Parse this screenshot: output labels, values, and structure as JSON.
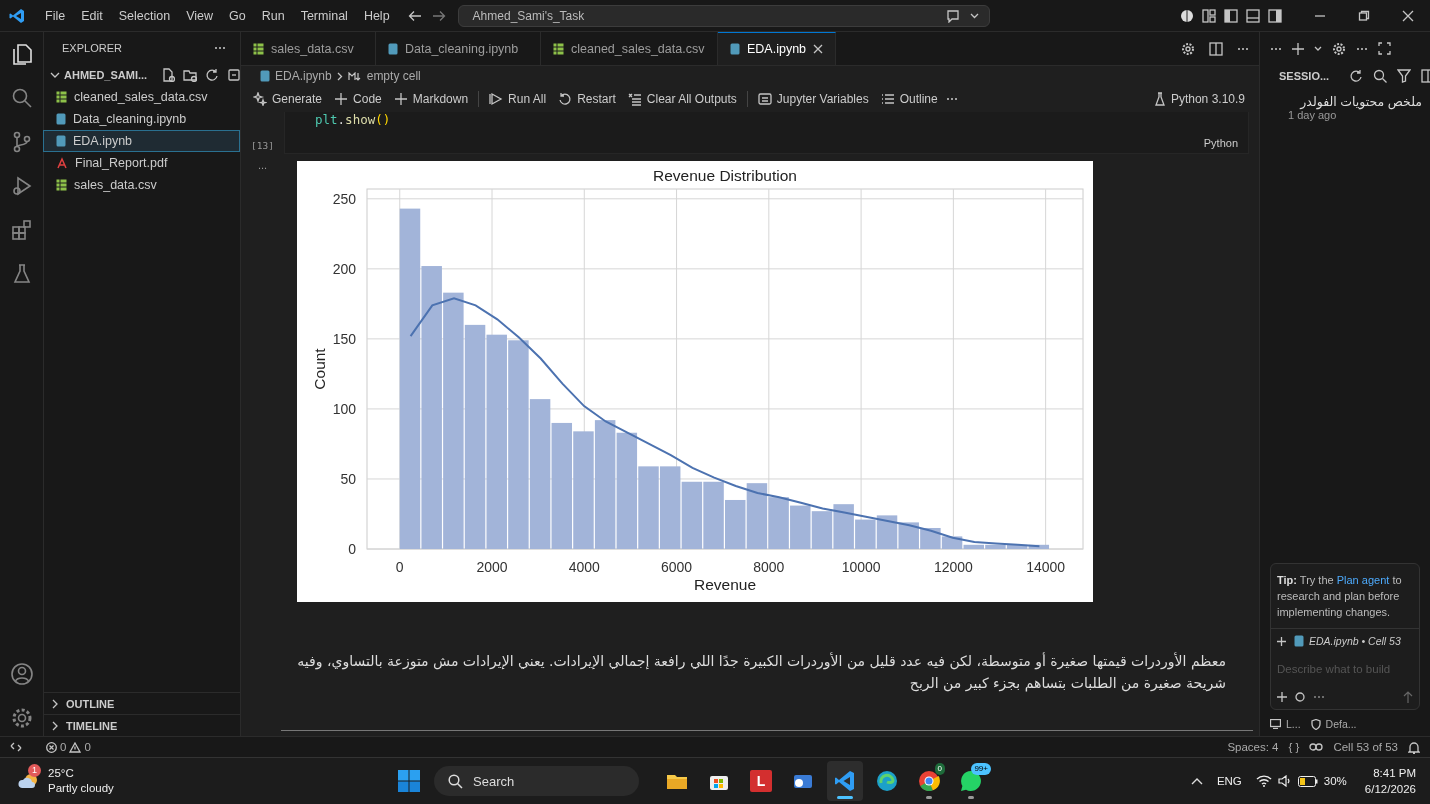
{
  "title_bar": {
    "menu": [
      "File",
      "Edit",
      "Selection",
      "View",
      "Go",
      "Run",
      "Terminal",
      "Help"
    ],
    "search": "Ahmed_Sami's_Task"
  },
  "sidebar": {
    "title": "EXPLORER",
    "folder": {
      "name": "AHMED_SAMI...",
      "expanded": true
    },
    "files": [
      {
        "name": "cleaned_sales_data.csv",
        "kind": "csv",
        "selected": false
      },
      {
        "name": "Data_cleaning.ipynb",
        "kind": "ipynb",
        "selected": false
      },
      {
        "name": "EDA.ipynb",
        "kind": "ipynb",
        "selected": true
      },
      {
        "name": "Final_Report.pdf",
        "kind": "pdf",
        "selected": false
      },
      {
        "name": "sales_data.csv",
        "kind": "csv",
        "selected": false
      }
    ],
    "sections": [
      {
        "label": "OUTLINE",
        "expanded": false
      },
      {
        "label": "TIMELINE",
        "expanded": false
      }
    ]
  },
  "editor": {
    "tabs": [
      {
        "label": "sales_data.csv",
        "kind": "csv",
        "selected": false
      },
      {
        "label": "Data_cleaning.ipynb",
        "kind": "ipynb",
        "selected": false
      },
      {
        "label": "cleaned_sales_data.csv",
        "kind": "csv",
        "selected": false
      },
      {
        "label": "EDA.ipynb",
        "kind": "ipynb",
        "selected": true
      }
    ],
    "breadcrumb": [
      "EDA.ipynb",
      "empty cell"
    ],
    "toolbar": [
      {
        "label": "Generate",
        "kind": "sparkle"
      },
      {
        "label": "Code",
        "kind": "plus"
      },
      {
        "label": "Markdown",
        "kind": "plus"
      },
      {
        "label": "Run All",
        "kind": "run"
      },
      {
        "label": "Restart",
        "kind": "restart"
      },
      {
        "label": "Clear All Outputs",
        "kind": "clear"
      },
      {
        "label": "Jupyter Variables",
        "kind": "variables"
      },
      {
        "label": "Outline",
        "kind": "list"
      }
    ],
    "kernel": "Python 3.10.9",
    "cell": {
      "code": [
        {
          "text": "plt",
          "kind": "object"
        },
        {
          "text": ".",
          "kind": "punct"
        },
        {
          "text": "show",
          "kind": "function"
        },
        {
          "text": "()",
          "kind": "paren"
        }
      ],
      "exec_count": "[13]",
      "language": "Python",
      "output_marker": "...",
      "chart_data": {
        "type": "bar",
        "title": "Revenue Distribution",
        "xlabel": "Revenue",
        "ylabel": "Count",
        "x": [
          235,
          705,
          1175,
          1645,
          2115,
          2585,
          3055,
          3525,
          3995,
          4465,
          4935,
          5405,
          5875,
          6345,
          6815,
          7285,
          7755,
          8225,
          8695,
          9165,
          9635,
          10105,
          10575,
          11045,
          11515,
          11985,
          12455,
          12925,
          13395,
          13865
        ],
        "series": [
          {
            "color": "#a2b4d9",
            "values": [
              243,
              202,
              183,
              160,
              153,
              149,
              107,
              90,
              84,
              92,
              83,
              59,
              59,
              48,
              48,
              35,
              47,
              37,
              31,
              27,
              32,
              21,
              24,
              19,
              15,
              9,
              3,
              3,
              3,
              3
            ]
          },
          {
            "type": "line",
            "color": "#4c72b0",
            "values": [
              152,
              174,
              179,
              174,
              164,
              151,
              136,
              118,
              102,
              91,
              83,
              75,
              67,
              58,
              51,
              45,
              40,
              37,
              33,
              29,
              26,
              23,
              20,
              17,
              13,
              8,
              5,
              4,
              3,
              2
            ]
          }
        ],
        "grid": true,
        "xlim": [
          -710,
          14810
        ],
        "ylim": [
          0,
          257
        ],
        "xticks": [
          0,
          2000,
          4000,
          6000,
          8000,
          10000,
          12000,
          14000
        ],
        "yticks": [
          0,
          50,
          100,
          150,
          200,
          250
        ]
      },
      "markdown": "معظم الأوردرات قيمتها صغيرة أو متوسطة، لكن فيه عدد قليل من الأوردرات الكبيرة جدًا اللي رافعة إجمالي الإيرادات. يعني الإيرادات مش متوزعة بالتساوي، وفيه شريحة صغيرة من الطلبات بتساهم بجزء كبير من الربح"
    }
  },
  "sessions_panel": {
    "title": "SESSIO...",
    "sessions": [
      {
        "title": "ملخص محتويات الفولدر",
        "time": "1 day ago"
      }
    ],
    "tip": {
      "lead": "**Tip:** Try the",
      "link": "Plan agent",
      "rest": "to research and plan before implementing changes."
    },
    "chat": {
      "context": "EDA.ipynb • Cell 53",
      "placeholder": "Describe what to build",
      "footer": [
        "L...",
        "Defa..."
      ]
    }
  },
  "status_bar": {
    "errors": "0",
    "warnings": "0",
    "right": [
      "Spaces: 4",
      "{ }",
      "Cell 53 of 53"
    ]
  },
  "taskbar": {
    "weather": {
      "badge": "1",
      "temp": "25°C",
      "desc": "Partly cloudy"
    },
    "search": "Search",
    "apps": [
      {
        "kind": "explorer",
        "running": false,
        "active": false
      },
      {
        "kind": "store",
        "running": false,
        "active": false
      },
      {
        "kind": "letter",
        "label": "L",
        "running": false,
        "active": false
      },
      {
        "kind": "mail",
        "running": false,
        "active": false
      },
      {
        "kind": "code",
        "running": true,
        "active": true
      },
      {
        "kind": "edge",
        "running": false,
        "active": false
      },
      {
        "kind": "chrome",
        "badge": "0",
        "running": true,
        "active": false
      },
      {
        "kind": "whatsapp",
        "badge": "99+",
        "running": true,
        "active": false
      }
    ],
    "lang": "ENG",
    "battery": "30%",
    "time": "8:41 PM",
    "date": "6/12/2026"
  }
}
